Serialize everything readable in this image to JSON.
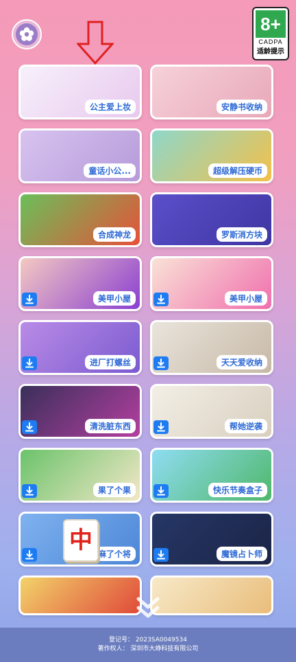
{
  "age_rating": {
    "age": "8+",
    "org": "CADPA",
    "tip": "适龄提示"
  },
  "games": [
    {
      "name": "公主爱上妆",
      "download": false,
      "colors": [
        "#f7f0fb",
        "#e8c9ee"
      ]
    },
    {
      "name": "安静书收纳",
      "download": false,
      "colors": [
        "#f6d1da",
        "#e8a8b8"
      ]
    },
    {
      "name": "童话小公...",
      "download": false,
      "colors": [
        "#d7c3f0",
        "#b69bd9"
      ]
    },
    {
      "name": "超级解压硬币",
      "download": false,
      "colors": [
        "#8fd7c9",
        "#f3c04a"
      ]
    },
    {
      "name": "合成神龙",
      "download": false,
      "colors": [
        "#6bbf5a",
        "#e6513a"
      ]
    },
    {
      "name": "罗斯消方块",
      "download": false,
      "colors": [
        "#5a4fc9",
        "#3f36a3"
      ]
    },
    {
      "name": "美甲小屋",
      "download": true,
      "colors": [
        "#f4c9c2",
        "#8a3fd1"
      ]
    },
    {
      "name": "美甲小屋",
      "download": true,
      "colors": [
        "#f9e2d6",
        "#f06fae"
      ]
    },
    {
      "name": "进厂打螺丝",
      "download": true,
      "colors": [
        "#b98be6",
        "#7b5bd0"
      ]
    },
    {
      "name": "天天爱收纳",
      "download": true,
      "colors": [
        "#e9e4dc",
        "#c7b9a6"
      ]
    },
    {
      "name": "清洗脏东西",
      "download": true,
      "colors": [
        "#3a2f5a",
        "#b43fa0"
      ]
    },
    {
      "name": "帮她逆袭",
      "download": true,
      "colors": [
        "#f3efe6",
        "#d8cfbf"
      ]
    },
    {
      "name": "果了个果",
      "download": true,
      "colors": [
        "#6bc36b",
        "#f2e7c7"
      ]
    },
    {
      "name": "快乐节奏盒子",
      "download": true,
      "colors": [
        "#8fdcf2",
        "#4fb86a"
      ]
    },
    {
      "name": "麻了个将",
      "download": true,
      "colors": [
        "#7fb2ef",
        "#4c86d6"
      ]
    },
    {
      "name": "魔镜占卜师",
      "download": true,
      "colors": [
        "#263766",
        "#1b2446"
      ]
    },
    {
      "name": "",
      "download": false,
      "colors": [
        "#f2d36a",
        "#e04a3a"
      ]
    },
    {
      "name": "",
      "download": false,
      "colors": [
        "#f7e9c9",
        "#e9bd7a"
      ]
    }
  ],
  "mahjong_tile": "中",
  "footer": {
    "registration": "登记号： 2023SA0049534",
    "copyright": "著作权人： 深圳市大峥科技有限公司"
  }
}
